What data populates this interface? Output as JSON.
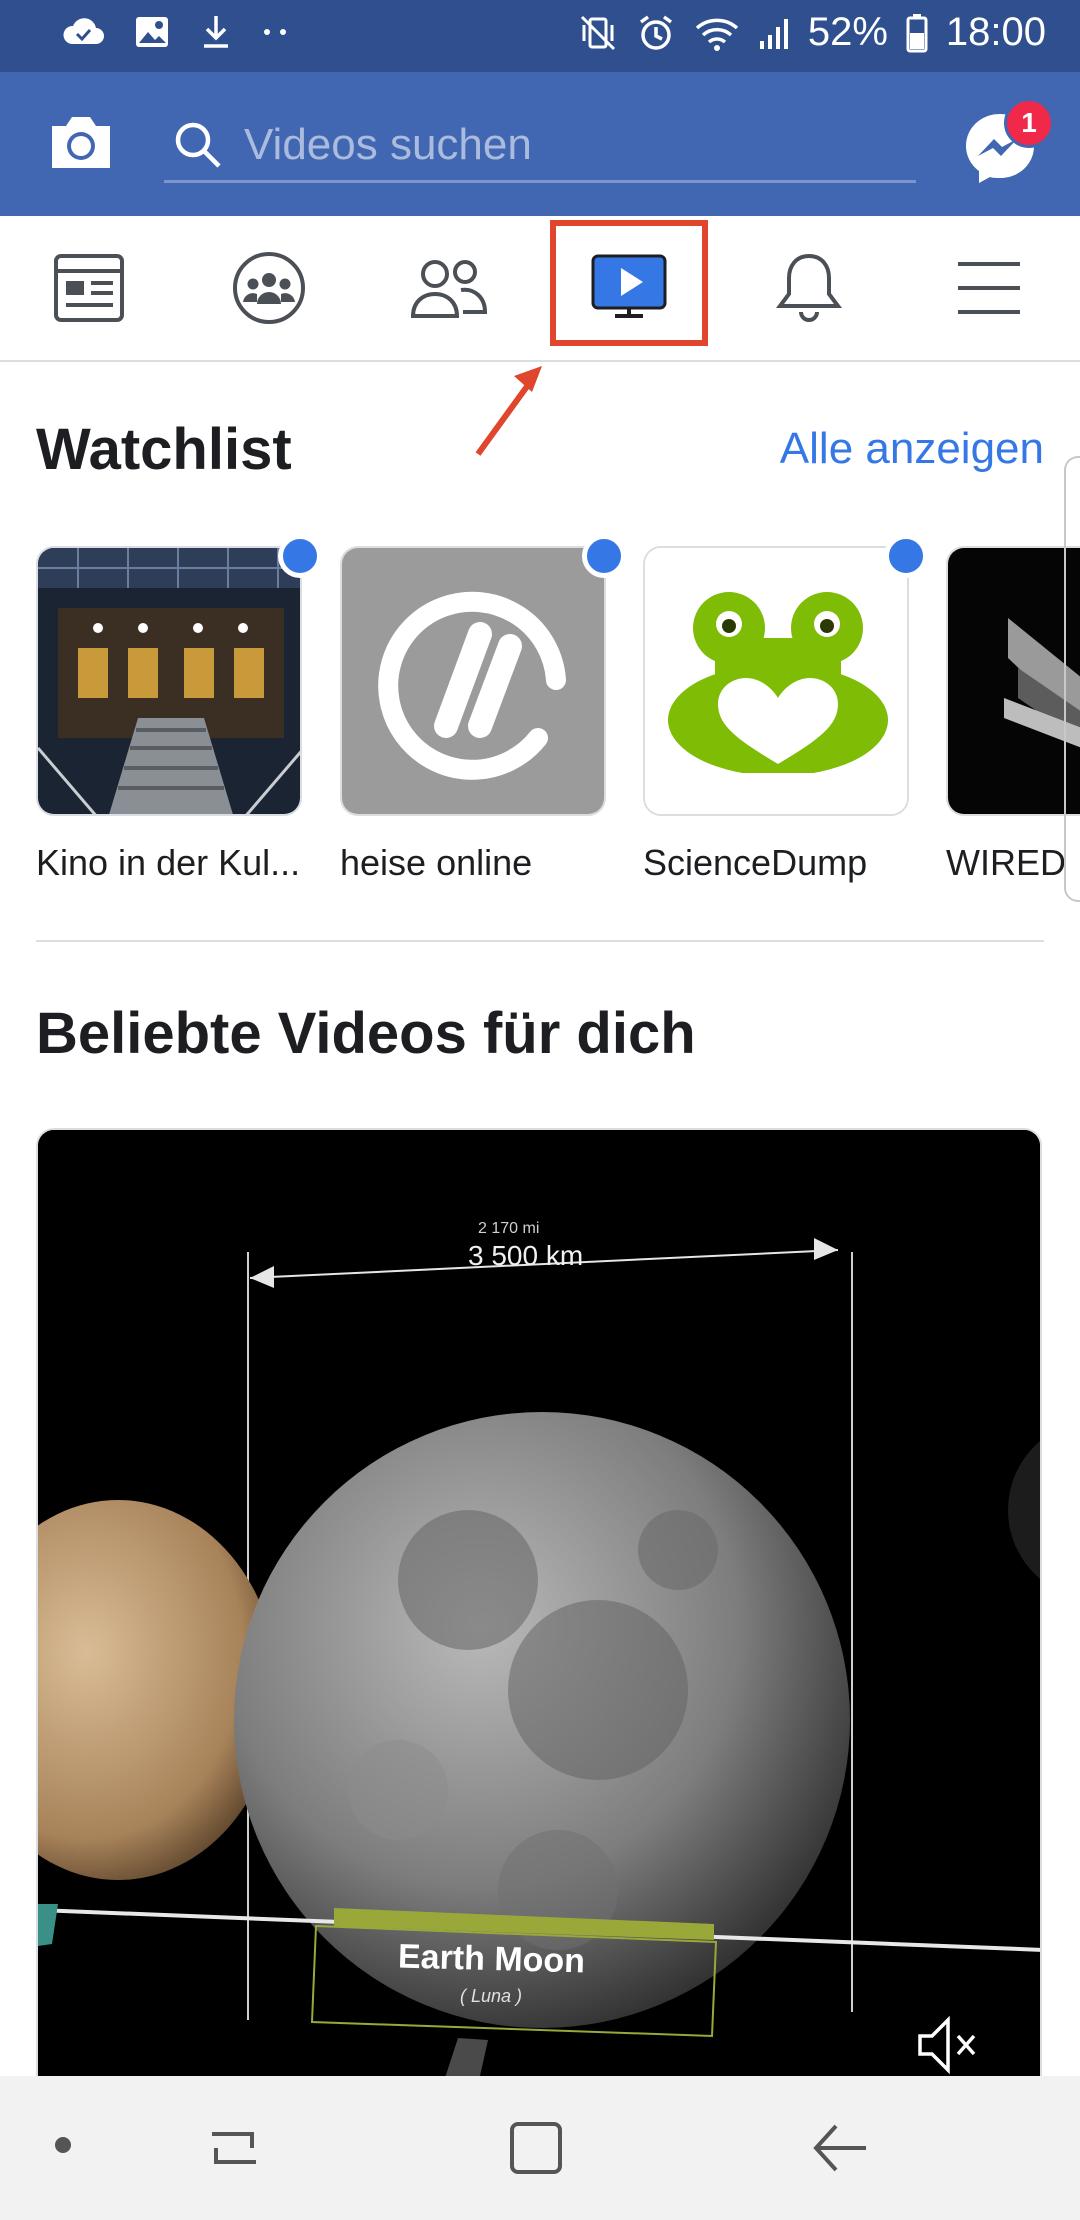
{
  "status_bar": {
    "battery": "52%",
    "time": "18:00"
  },
  "header": {
    "search_placeholder": "Videos suchen",
    "messenger_badge": "1"
  },
  "tabs": [
    {
      "name": "news-feed",
      "icon": "news-feed-icon"
    },
    {
      "name": "groups",
      "icon": "groups-icon"
    },
    {
      "name": "friends",
      "icon": "friends-icon"
    },
    {
      "name": "watch",
      "icon": "watch-icon",
      "selected": true
    },
    {
      "name": "notifications",
      "icon": "bell-icon"
    },
    {
      "name": "menu",
      "icon": "hamburger-icon"
    }
  ],
  "watchlist": {
    "title": "Watchlist",
    "see_all": "Alle anzeigen",
    "items": [
      {
        "label": "Kino in der Kul...",
        "new": true
      },
      {
        "label": "heise online",
        "new": true
      },
      {
        "label": "ScienceDump",
        "new": true
      },
      {
        "label": "WIRED",
        "new": false
      }
    ]
  },
  "recommended": {
    "title": "Beliebte Videos für dich",
    "video": {
      "measure_mi": "2 170   mi",
      "measure_km": "3 500 km",
      "caption": "Earth Moon",
      "caption_sub": "( Luna )"
    }
  },
  "colors": {
    "status_bar": "#2f4f8f",
    "header": "#4267b2",
    "accent": "#3578e5",
    "highlight": "#e0452d",
    "badge": "#f0284a"
  }
}
